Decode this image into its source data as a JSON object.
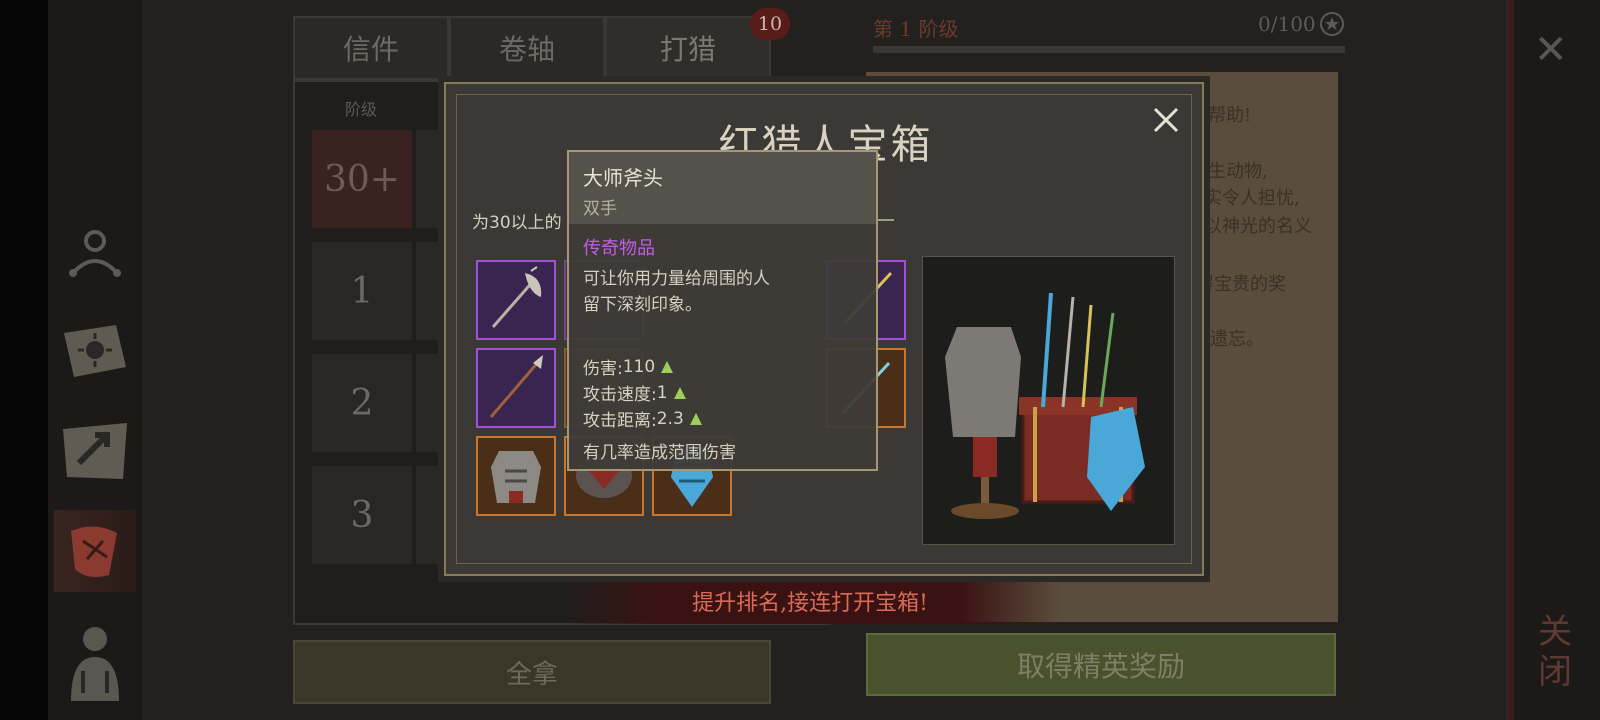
{
  "tabs": [
    {
      "label": "信件",
      "active": false
    },
    {
      "label": "卷轴",
      "active": false
    },
    {
      "label": "打猎",
      "active": true,
      "badge": "10"
    }
  ],
  "rank_list": {
    "column_header": "阶级",
    "rows": [
      {
        "rank": "30+",
        "highlight": true
      },
      {
        "rank": "1"
      },
      {
        "rank": "2"
      },
      {
        "rank": "3"
      }
    ]
  },
  "level": {
    "label": "第 1 阶级",
    "progress_text": "0/100",
    "progress": 0
  },
  "parchment_lines": [
    "的帮助!",
    "野生动物,",
    "实令人担忧,",
    "以神光的名义",
    "得宝贵的奖",
    "被遗忘。",
    "。"
  ],
  "modal": {
    "title": "红猎人宝箱",
    "subtitle": "为30以上的",
    "items": [
      {
        "icon": "halberd-icon",
        "rarity": "legendary"
      },
      {
        "icon": "spear-icon",
        "rarity": "legendary"
      },
      {
        "icon": "armor-icon",
        "rarity": "epic"
      },
      {
        "icon": "shield-icon",
        "rarity": "epic"
      },
      {
        "icon": "crystal-shield-icon",
        "rarity": "epic"
      },
      {
        "icon": "sword-icon",
        "rarity": "legendary"
      },
      {
        "icon": "glaive-icon",
        "rarity": "epic"
      }
    ]
  },
  "tooltip": {
    "name": "大师斧头",
    "type": "双手",
    "rarity": "传奇物品",
    "description": [
      "可让你用力量给周围的人",
      "留下深刻印象。"
    ],
    "stats": [
      {
        "label": "伤害:",
        "value": "110"
      },
      {
        "label": "攻击速度:",
        "value": "1"
      },
      {
        "label": "攻击距离:",
        "value": "2.3"
      }
    ],
    "effect": "有几率造成范围伤害"
  },
  "banner": "提升排名,接连打开宝箱!",
  "buttons": {
    "take_all": "全拿",
    "elite_reward": "取得精英奖励",
    "close_vertical": "关闭"
  },
  "colors": {
    "legendary": "#a54fd8",
    "epic": "#c9752c",
    "stat_up": "#9ccf5a",
    "banner_text": "#d86a58"
  }
}
